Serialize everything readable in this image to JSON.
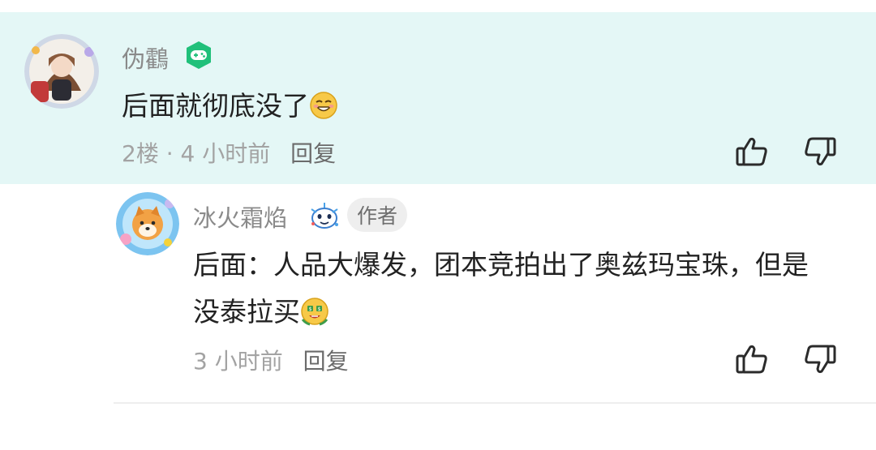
{
  "comment": {
    "username": "伪鸖",
    "level_badge_icon": "game-controller-badge-icon",
    "text": "后面就彻底没了",
    "emoji_icon": "grin-emoji-icon",
    "floor": "2楼",
    "separator": "·",
    "time": "4 小时前",
    "reply_label": "回复",
    "accent": "#20c07a",
    "background": "#e4f7f6"
  },
  "reply": {
    "username": "冰火霜焰",
    "fan_badge_icon": "fan-badge-icon",
    "author_tag": "作者",
    "text": "后面：人品大爆发，团本竞拍出了奥兹玛宝珠，但是没泰拉买",
    "emoji_icon": "rich-emoji-icon",
    "time": "3 小时前",
    "reply_label": "回复"
  }
}
